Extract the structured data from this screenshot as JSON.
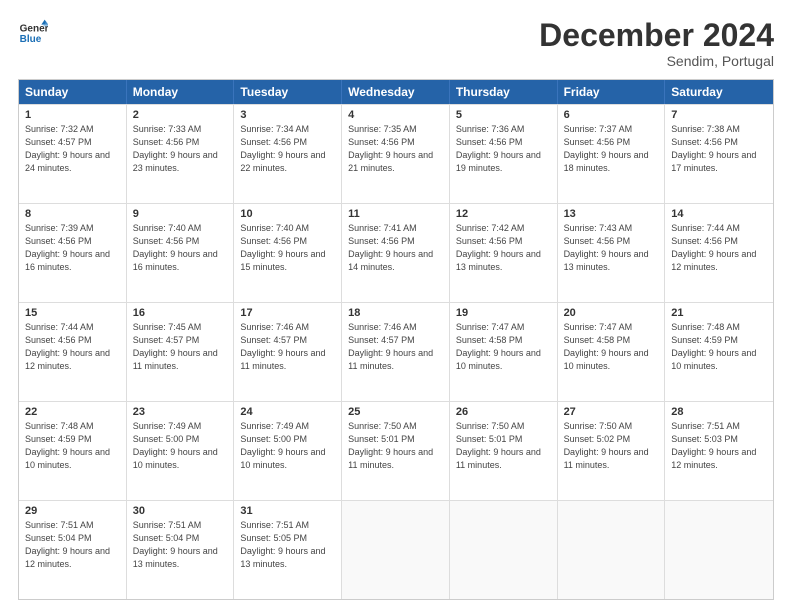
{
  "logo": {
    "line1": "General",
    "line2": "Blue"
  },
  "header": {
    "month": "December 2024",
    "location": "Sendim, Portugal"
  },
  "weekdays": [
    "Sunday",
    "Monday",
    "Tuesday",
    "Wednesday",
    "Thursday",
    "Friday",
    "Saturday"
  ],
  "rows": [
    [
      {
        "day": "",
        "info": ""
      },
      {
        "day": "2",
        "info": "Sunrise: 7:33 AM\nSunset: 4:56 PM\nDaylight: 9 hours\nand 23 minutes."
      },
      {
        "day": "3",
        "info": "Sunrise: 7:34 AM\nSunset: 4:56 PM\nDaylight: 9 hours\nand 22 minutes."
      },
      {
        "day": "4",
        "info": "Sunrise: 7:35 AM\nSunset: 4:56 PM\nDaylight: 9 hours\nand 21 minutes."
      },
      {
        "day": "5",
        "info": "Sunrise: 7:36 AM\nSunset: 4:56 PM\nDaylight: 9 hours\nand 19 minutes."
      },
      {
        "day": "6",
        "info": "Sunrise: 7:37 AM\nSunset: 4:56 PM\nDaylight: 9 hours\nand 18 minutes."
      },
      {
        "day": "7",
        "info": "Sunrise: 7:38 AM\nSunset: 4:56 PM\nDaylight: 9 hours\nand 17 minutes."
      }
    ],
    [
      {
        "day": "8",
        "info": "Sunrise: 7:39 AM\nSunset: 4:56 PM\nDaylight: 9 hours\nand 16 minutes."
      },
      {
        "day": "9",
        "info": "Sunrise: 7:40 AM\nSunset: 4:56 PM\nDaylight: 9 hours\nand 16 minutes."
      },
      {
        "day": "10",
        "info": "Sunrise: 7:40 AM\nSunset: 4:56 PM\nDaylight: 9 hours\nand 15 minutes."
      },
      {
        "day": "11",
        "info": "Sunrise: 7:41 AM\nSunset: 4:56 PM\nDaylight: 9 hours\nand 14 minutes."
      },
      {
        "day": "12",
        "info": "Sunrise: 7:42 AM\nSunset: 4:56 PM\nDaylight: 9 hours\nand 13 minutes."
      },
      {
        "day": "13",
        "info": "Sunrise: 7:43 AM\nSunset: 4:56 PM\nDaylight: 9 hours\nand 13 minutes."
      },
      {
        "day": "14",
        "info": "Sunrise: 7:44 AM\nSunset: 4:56 PM\nDaylight: 9 hours\nand 12 minutes."
      }
    ],
    [
      {
        "day": "15",
        "info": "Sunrise: 7:44 AM\nSunset: 4:56 PM\nDaylight: 9 hours\nand 12 minutes."
      },
      {
        "day": "16",
        "info": "Sunrise: 7:45 AM\nSunset: 4:57 PM\nDaylight: 9 hours\nand 11 minutes."
      },
      {
        "day": "17",
        "info": "Sunrise: 7:46 AM\nSunset: 4:57 PM\nDaylight: 9 hours\nand 11 minutes."
      },
      {
        "day": "18",
        "info": "Sunrise: 7:46 AM\nSunset: 4:57 PM\nDaylight: 9 hours\nand 11 minutes."
      },
      {
        "day": "19",
        "info": "Sunrise: 7:47 AM\nSunset: 4:58 PM\nDaylight: 9 hours\nand 10 minutes."
      },
      {
        "day": "20",
        "info": "Sunrise: 7:47 AM\nSunset: 4:58 PM\nDaylight: 9 hours\nand 10 minutes."
      },
      {
        "day": "21",
        "info": "Sunrise: 7:48 AM\nSunset: 4:59 PM\nDaylight: 9 hours\nand 10 minutes."
      }
    ],
    [
      {
        "day": "22",
        "info": "Sunrise: 7:48 AM\nSunset: 4:59 PM\nDaylight: 9 hours\nand 10 minutes."
      },
      {
        "day": "23",
        "info": "Sunrise: 7:49 AM\nSunset: 5:00 PM\nDaylight: 9 hours\nand 10 minutes."
      },
      {
        "day": "24",
        "info": "Sunrise: 7:49 AM\nSunset: 5:00 PM\nDaylight: 9 hours\nand 10 minutes."
      },
      {
        "day": "25",
        "info": "Sunrise: 7:50 AM\nSunset: 5:01 PM\nDaylight: 9 hours\nand 11 minutes."
      },
      {
        "day": "26",
        "info": "Sunrise: 7:50 AM\nSunset: 5:01 PM\nDaylight: 9 hours\nand 11 minutes."
      },
      {
        "day": "27",
        "info": "Sunrise: 7:50 AM\nSunset: 5:02 PM\nDaylight: 9 hours\nand 11 minutes."
      },
      {
        "day": "28",
        "info": "Sunrise: 7:51 AM\nSunset: 5:03 PM\nDaylight: 9 hours\nand 12 minutes."
      }
    ],
    [
      {
        "day": "29",
        "info": "Sunrise: 7:51 AM\nSunset: 5:04 PM\nDaylight: 9 hours\nand 12 minutes."
      },
      {
        "day": "30",
        "info": "Sunrise: 7:51 AM\nSunset: 5:04 PM\nDaylight: 9 hours\nand 13 minutes."
      },
      {
        "day": "31",
        "info": "Sunrise: 7:51 AM\nSunset: 5:05 PM\nDaylight: 9 hours\nand 13 minutes."
      },
      {
        "day": "",
        "info": ""
      },
      {
        "day": "",
        "info": ""
      },
      {
        "day": "",
        "info": ""
      },
      {
        "day": "",
        "info": ""
      }
    ]
  ],
  "first_row_first_day": {
    "day": "1",
    "info": "Sunrise: 7:32 AM\nSunset: 4:57 PM\nDaylight: 9 hours\nand 24 minutes."
  }
}
